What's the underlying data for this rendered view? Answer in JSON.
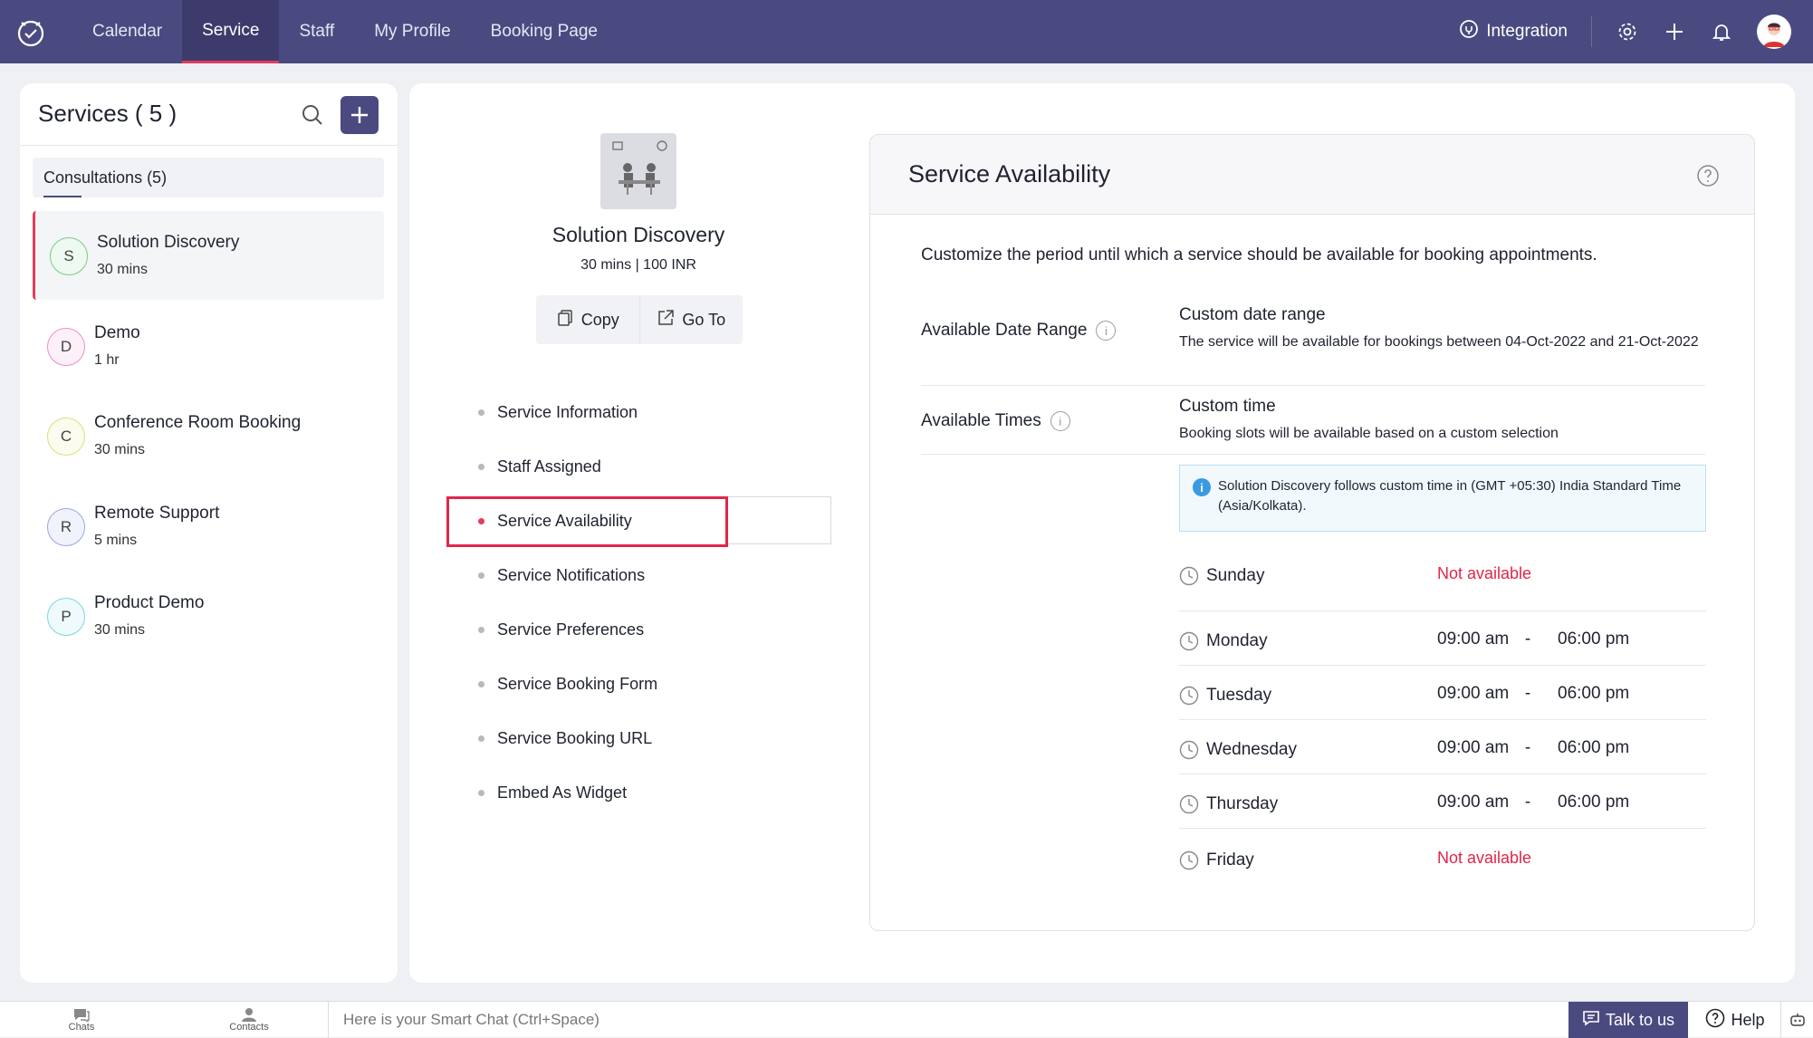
{
  "topbar": {
    "nav": [
      "Calendar",
      "Service",
      "Staff",
      "My Profile",
      "Booking Page"
    ],
    "active_nav": "Service",
    "integration_label": "Integration"
  },
  "services": {
    "title": "Services ( 5 )",
    "category_label": "Consultations (5)",
    "items": [
      {
        "initial": "S",
        "name": "Solution Discovery",
        "duration": "30 mins",
        "color": "#7cc98a"
      },
      {
        "initial": "D",
        "name": "Demo",
        "duration": "1 hr",
        "color": "#e88fc7"
      },
      {
        "initial": "C",
        "name": "Conference Room Booking",
        "duration": "30 mins",
        "color": "#d9e07a"
      },
      {
        "initial": "R",
        "name": "Remote Support",
        "duration": "5 mins",
        "color": "#9aa6e0"
      },
      {
        "initial": "P",
        "name": "Product Demo",
        "duration": "30 mins",
        "color": "#7fd4e0"
      }
    ]
  },
  "service_detail": {
    "name": "Solution Discovery",
    "summary": "30 mins | 100 INR",
    "copy_label": "Copy",
    "goto_label": "Go To",
    "menu": [
      "Service Information",
      "Staff Assigned",
      "Service Availability",
      "Service Notifications",
      "Service Preferences",
      "Service Booking Form",
      "Service Booking URL",
      "Embed As Widget"
    ],
    "active_menu": "Service Availability"
  },
  "availability": {
    "title": "Service Availability",
    "description": "Customize the period until which a service should be available for booking appointments.",
    "date_range": {
      "label": "Available Date Range",
      "value_title": "Custom date range",
      "value_desc": "The service will be available for bookings between 04-Oct-2022 and 21-Oct-2022"
    },
    "times": {
      "label": "Available Times",
      "value_title": "Custom time",
      "value_desc": "Booking slots will be available based on a custom selection"
    },
    "timezone_note": "Solution Discovery follows custom time in (GMT +05:30) India Standard Time (Asia/Kolkata).",
    "days": [
      {
        "day": "Sunday",
        "available": false,
        "status": "Not available"
      },
      {
        "day": "Monday",
        "available": true,
        "from": "09:00 am",
        "to": "06:00 pm"
      },
      {
        "day": "Tuesday",
        "available": true,
        "from": "09:00 am",
        "to": "06:00 pm"
      },
      {
        "day": "Wednesday",
        "available": true,
        "from": "09:00 am",
        "to": "06:00 pm"
      },
      {
        "day": "Thursday",
        "available": true,
        "from": "09:00 am",
        "to": "06:00 pm"
      },
      {
        "day": "Friday",
        "available": false,
        "status": "Not available"
      }
    ],
    "dash": "-"
  },
  "bottombar": {
    "chats_label": "Chats",
    "contacts_label": "Contacts",
    "smart_chat_placeholder": "Here is your Smart Chat (Ctrl+Space)",
    "talk_label": "Talk to us",
    "help_label": "Help"
  },
  "colors": {
    "brand": "#4b4a80",
    "accent": "#e23d5a",
    "not_available": "#e0264a"
  }
}
